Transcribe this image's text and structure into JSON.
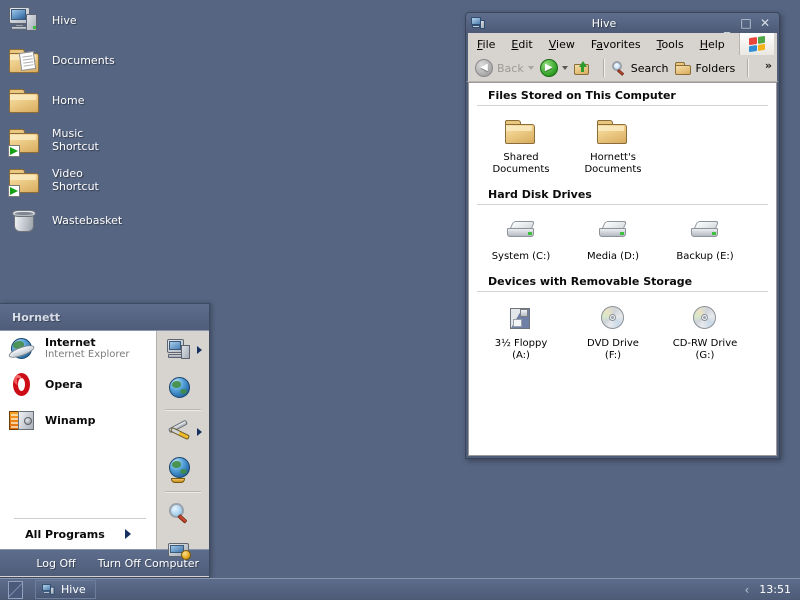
{
  "desktop": {
    "background_color": "#566582",
    "icons": [
      {
        "label": "Hive",
        "icon": "computer-icon",
        "shortcut": false
      },
      {
        "label": "Documents",
        "icon": "documents-folder-icon",
        "shortcut": false
      },
      {
        "label": "Home",
        "icon": "folder-icon",
        "shortcut": false
      },
      {
        "label": "Music\nShortcut",
        "icon": "folder-icon",
        "shortcut": true
      },
      {
        "label": "Video\nShortcut",
        "icon": "folder-icon",
        "shortcut": true
      },
      {
        "label": "Wastebasket",
        "icon": "wastebasket-icon",
        "shortcut": false
      }
    ]
  },
  "start_menu": {
    "user_name": "Hornett",
    "programs": [
      {
        "title": "Internet",
        "subtitle": "Internet Explorer",
        "icon": "internet-explorer-icon"
      },
      {
        "title": "Opera",
        "subtitle": "",
        "icon": "opera-icon"
      },
      {
        "title": "Winamp",
        "subtitle": "",
        "icon": "winamp-icon"
      }
    ],
    "all_programs_label": "All Programs",
    "right_items": [
      {
        "icon": "my-computer-icon",
        "has_arrow": true
      },
      {
        "icon": "globe-icon",
        "has_arrow": false
      },
      {
        "icon": "tools-icon",
        "has_arrow": true
      },
      {
        "icon": "globe-stand-icon",
        "has_arrow": false
      },
      {
        "icon": "search-magnifier-icon",
        "has_arrow": false
      },
      {
        "icon": "control-panel-icon",
        "has_arrow": false
      }
    ],
    "log_off_label": "Log Off",
    "turn_off_label": "Turn Off Computer"
  },
  "explorer": {
    "title": "Hive",
    "window_icon": "computer-icon",
    "controls": {
      "minimize": "_",
      "maximize": "□",
      "close": "✕"
    },
    "menu": [
      {
        "accel": "F",
        "rest": "ile"
      },
      {
        "accel": "E",
        "rest": "dit"
      },
      {
        "accel": "V",
        "rest": "iew"
      },
      {
        "pre": "F",
        "accel": "a",
        "rest": "vorites"
      },
      {
        "accel": "T",
        "rest": "ools"
      },
      {
        "accel": "H",
        "rest": "elp"
      }
    ],
    "flag_colors": [
      "#e8453c",
      "#4fa845",
      "#2f8ed6",
      "#f2b31b"
    ],
    "toolbar": {
      "back_label": "Back",
      "search_label": "Search",
      "folders_label": "Folders",
      "overflow_label": "»"
    },
    "groups": [
      {
        "title": "Files Stored on This Computer",
        "items": [
          {
            "label": "Shared\nDocuments",
            "icon": "folder-icon"
          },
          {
            "label": "Hornett's\nDocuments",
            "icon": "folder-icon"
          }
        ]
      },
      {
        "title": "Hard Disk Drives",
        "items": [
          {
            "label": "System (C:)",
            "icon": "hard-disk-icon"
          },
          {
            "label": "Media (D:)",
            "icon": "hard-disk-icon"
          },
          {
            "label": "Backup (E:)",
            "icon": "hard-disk-icon"
          }
        ]
      },
      {
        "title": "Devices with Removable Storage",
        "items": [
          {
            "label": "3½ Floppy\n(A:)",
            "icon": "floppy-drive-icon"
          },
          {
            "label": "DVD Drive\n(F:)",
            "icon": "optical-drive-icon"
          },
          {
            "label": "CD-RW Drive\n(G:)",
            "icon": "optical-drive-icon"
          }
        ]
      }
    ]
  },
  "taskbar": {
    "start_button_label": "",
    "tasks": [
      {
        "label": "Hive",
        "icon": "computer-icon",
        "active": true
      }
    ],
    "tray_chevron": "‹",
    "clock": "13:51"
  }
}
